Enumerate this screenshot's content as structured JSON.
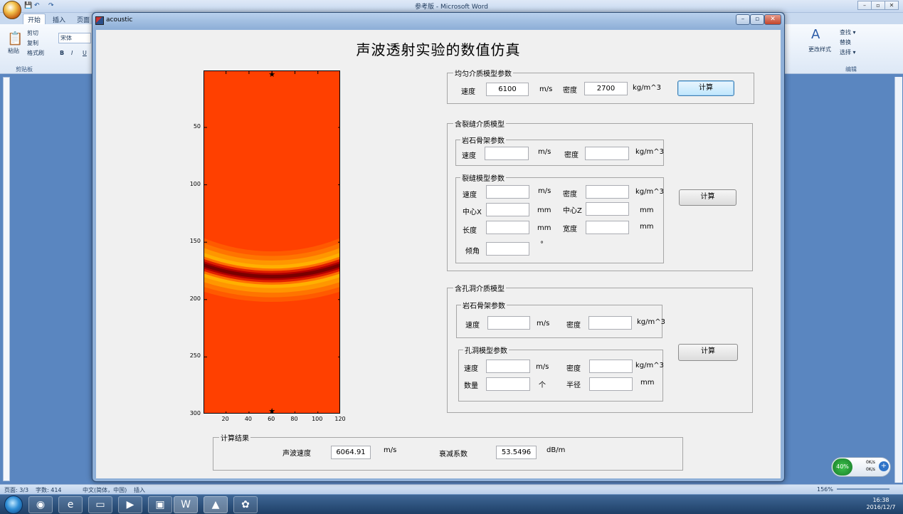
{
  "word": {
    "title": "参考版 - Microsoft Word",
    "qat_icons": [
      "save-icon",
      "undo-icon",
      "redo-icon"
    ],
    "tabs": [
      "开始",
      "插入",
      "页面"
    ],
    "ribbon": {
      "paste_label": "粘贴",
      "cut_label": "剪切",
      "copy_label": "复制",
      "format_painter_label": "格式刷",
      "font_name": "宋体",
      "clipboard_group_label": "剪贴板",
      "change_styles_label": "更改样式",
      "find_label": "查找 ▾",
      "replace_label": "替换",
      "select_label": "选择 ▾",
      "edit_group_label": "编辑"
    },
    "status": {
      "page": "页面: 3/3",
      "words": "字数: 414",
      "language": "中文(简体，中国)",
      "insert": "插入",
      "zoom": "156%"
    },
    "widget": {
      "percent": "40%",
      "up": "0K/s",
      "down": "0K/s"
    },
    "clock": {
      "time": "16:38",
      "date": "2016/12/7"
    }
  },
  "figure": {
    "window_title": "acoustic",
    "main_title": "声波透射实验的数值仿真",
    "uniform": {
      "legend": "均匀介质模型参数",
      "speed_label": "速度",
      "speed_value": "6100",
      "speed_unit": "m/s",
      "density_label": "密度",
      "density_value": "2700",
      "density_unit": "kg/m^3",
      "calc_label": "计算"
    },
    "crack": {
      "legend": "含裂缝介质模型",
      "rock_legend": "岩石骨架参数",
      "rock_speed_label": "速度",
      "rock_speed_unit": "m/s",
      "rock_density_label": "密度",
      "rock_density_unit": "kg/m^3",
      "model_legend": "裂缝模型参数",
      "speed_label": "速度",
      "speed_unit": "m/s",
      "density_label": "密度",
      "density_unit": "kg/m^3",
      "cx_label": "中心X",
      "cx_unit": "mm",
      "cz_label": "中心Z",
      "cz_unit": "mm",
      "length_label": "长度",
      "length_unit": "mm",
      "width_label": "宽度",
      "width_unit": "mm",
      "angle_label": "倾角",
      "angle_unit": "°",
      "calc_label": "计算"
    },
    "hole": {
      "legend": "含孔洞介质模型",
      "rock_legend": "岩石骨架参数",
      "rock_speed_label": "速度",
      "rock_speed_unit": "m/s",
      "rock_density_label": "密度",
      "rock_density_unit": "kg/m^3",
      "model_legend": "孔洞模型参数",
      "speed_label": "速度",
      "speed_unit": "m/s",
      "density_label": "密度",
      "density_unit": "kg/m^3",
      "count_label": "数量",
      "count_unit": "个",
      "radius_label": "半径",
      "radius_unit": "mm",
      "calc_label": "计算"
    },
    "results": {
      "legend": "计算结果",
      "speed_label": "声波速度",
      "speed_value": "6064.91",
      "speed_unit": "m/s",
      "atten_label": "衰减系数",
      "atten_value": "53.5496",
      "atten_unit": "dB/m"
    }
  },
  "chart_data": {
    "type": "heatmap",
    "x_ticks": [
      "20",
      "40",
      "60",
      "80",
      "100",
      "120"
    ],
    "y_ticks": [
      "50",
      "100",
      "150",
      "200",
      "250",
      "300"
    ],
    "xlim": [
      1,
      120
    ],
    "ylim": [
      1,
      300
    ],
    "y_reversed": true,
    "wavefront": {
      "source_x": 60,
      "source_y": 0,
      "radius": 180,
      "band_halfwidth": 22
    },
    "source_marker": {
      "x": 60,
      "y": 0
    },
    "receiver_marker": {
      "x": 60,
      "y": 300
    },
    "background_color": "#ff4000",
    "peak_color": "#7a0000",
    "shoulder_color": "#ffb000"
  }
}
